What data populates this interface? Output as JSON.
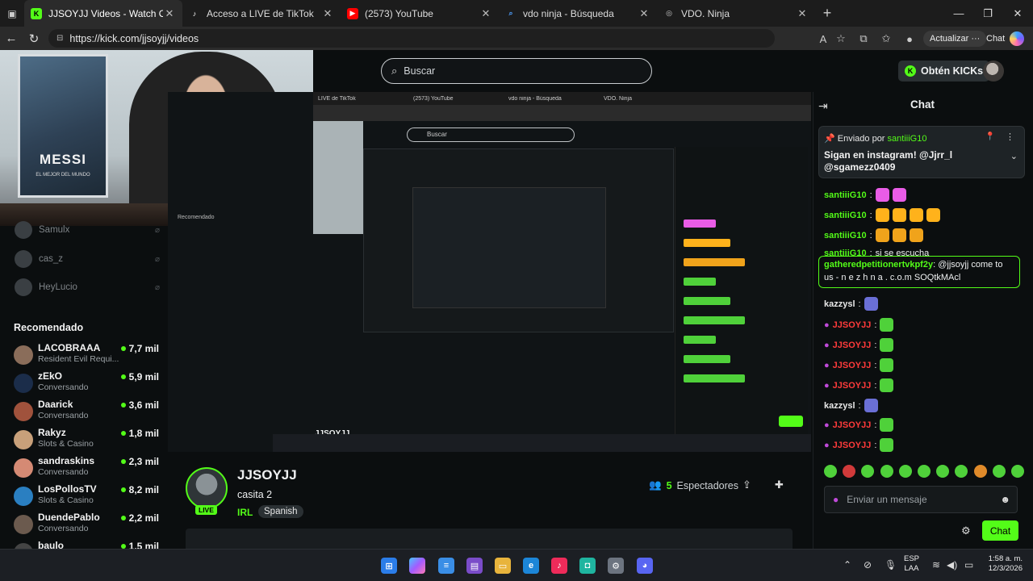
{
  "browser": {
    "tabs": [
      {
        "label": "JJSOYJJ Videos - Watch On-Deman",
        "favicon": "kick",
        "active": true
      },
      {
        "label": "Acceso a LIVE de TikTok",
        "favicon": "tiktok",
        "active": false
      },
      {
        "label": "(2573) YouTube",
        "favicon": "youtube",
        "active": false
      },
      {
        "label": "vdo ninja - Búsqueda",
        "favicon": "bing",
        "active": false
      },
      {
        "label": "VDO. Ninja",
        "favicon": "globe",
        "active": false
      }
    ],
    "url": "https://kick.com/jjsoyjj/videos",
    "update_label": "Actualizar",
    "copilot_label": "Chat"
  },
  "header": {
    "search_placeholder": "Buscar",
    "kicks_label": "Obtén KICKs"
  },
  "webcam": {
    "poster_text": "MESSI",
    "poster_sub": "EL MEJOR DEL MUNDO"
  },
  "sidebar": {
    "followed": [
      {
        "name": "Samulx"
      },
      {
        "name": "cas_z"
      },
      {
        "name": "HeyLucio"
      }
    ],
    "recommended_title": "Recomendado",
    "recommended": [
      {
        "name": "LACOBRAAA",
        "category": "Resident Evil Requi...",
        "viewers": "7,7 mil",
        "color": "#8a6d5a"
      },
      {
        "name": "zEkO",
        "category": "Conversando",
        "viewers": "5,9 mil",
        "color": "#1b2d4a"
      },
      {
        "name": "Daarick",
        "category": "Conversando",
        "viewers": "3,6 mil",
        "color": "#a0523c"
      },
      {
        "name": "Rakyz",
        "category": "Slots & Casino",
        "viewers": "1,8 mil",
        "color": "#c8a07a"
      },
      {
        "name": "sandraskins",
        "category": "Conversando",
        "viewers": "2,3 mil",
        "color": "#d58a74"
      },
      {
        "name": "LosPollosTV",
        "category": "Slots & Casino",
        "viewers": "8,2 mil",
        "color": "#2a7fc1"
      },
      {
        "name": "DuendePablo",
        "category": "Conversando",
        "viewers": "2,2 mil",
        "color": "#6b5a4e"
      },
      {
        "name": "baulo",
        "category": "",
        "viewers": "1,5 mil",
        "color": "#444"
      }
    ]
  },
  "nested": {
    "tab1": "LIVE de TikTok",
    "tab2": "(2573) YouTube",
    "tab3": "vdo ninja - Búsqueda",
    "tab4": "VDO. Ninja",
    "search": "Buscar",
    "title": "JJSOYJJ"
  },
  "channel": {
    "name": "JJSOYJJ",
    "stream_title": "casita 2",
    "category": "IRL",
    "language": "Spanish",
    "live_label": "LIVE",
    "viewers_count": "5",
    "viewers_label": "Espectadores"
  },
  "chat": {
    "title": "Chat",
    "pinned": {
      "sent_by_label": "Enviado por",
      "sender": "santiiiG10",
      "message": "Sigan en instagram! @Jjrr_l @sgamezz0409"
    },
    "messages": [
      {
        "user": "santiiiG10",
        "color": "#53fc18",
        "text": ""
      },
      {
        "user": "santiiiG10",
        "color": "#53fc18",
        "text": ""
      },
      {
        "user": "santiiiG10",
        "color": "#53fc18",
        "text": ""
      },
      {
        "user": "santiiiG10",
        "color": "#53fc18",
        "text": "si se escucha"
      }
    ],
    "highlight": {
      "user": "gatheredpetitionertvkpf2y",
      "text": "@jjsoyjj come to us - n e z h n a . c.o.m SOQtkMAcl"
    },
    "messages2": [
      {
        "user": "kazzysl",
        "color": "#e8e8e8",
        "mic": false
      },
      {
        "user": "JJSOYJJ",
        "color": "#ff3b3b",
        "mic": true
      },
      {
        "user": "JJSOYJJ",
        "color": "#ff3b3b",
        "mic": true
      },
      {
        "user": "JJSOYJJ",
        "color": "#ff3b3b",
        "mic": true
      },
      {
        "user": "JJSOYJJ",
        "color": "#ff3b3b",
        "mic": true
      },
      {
        "user": "kazzysl",
        "color": "#e8e8e8",
        "mic": false
      },
      {
        "user": "JJSOYJJ",
        "color": "#ff3b3b",
        "mic": true
      },
      {
        "user": "JJSOYJJ",
        "color": "#ff3b3b",
        "mic": true
      }
    ],
    "input_placeholder": "Enviar un mensaje",
    "send_label": "Chat"
  },
  "taskbar": {
    "lang_line1": "ESP",
    "lang_line2": "LAA",
    "time": "1:58 a. m.",
    "date": "12/3/2026"
  },
  "colors": {
    "accent": "#53fc18",
    "background": "#0b0e0f",
    "mod_red": "#ff3b3b"
  }
}
